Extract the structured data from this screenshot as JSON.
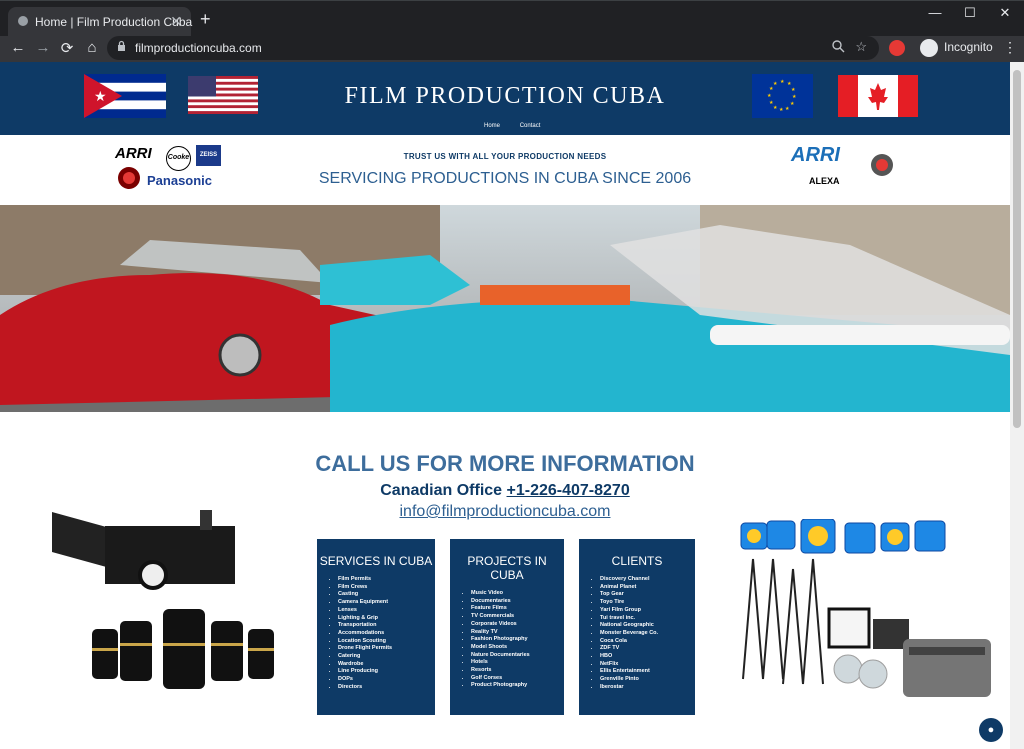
{
  "browser": {
    "tab_title": "Home | Film Production Cuba",
    "tab_close": "✕",
    "new_tab": "+",
    "minimize": "—",
    "maximize": "☐",
    "close_window": "✕",
    "back": "←",
    "forward": "→",
    "reload": "⟳",
    "home": "⌂",
    "url": "filmproductioncuba.com",
    "incognito_label": "Incognito",
    "menu": "⋮"
  },
  "header": {
    "site_title": "FILM PRODUCTION CUBA",
    "nav": [
      "Home",
      "Contact"
    ]
  },
  "brand_strip": {
    "tagline_small": "TRUST US WITH ALL YOUR PRODUCTION NEEDS",
    "tagline_big": "SERVICING PRODUCTIONS IN CUBA SINCE 2006",
    "logos_left": [
      "ARRI",
      "Cooke",
      "ZEISS",
      "Panasonic"
    ],
    "logos_right": [
      "ARRI",
      "ALEXA"
    ]
  },
  "cta": {
    "title": "CALL US FOR MORE INFORMATION",
    "phone_prefix": "Canadian Office",
    "phone": "+1-226-407-8270",
    "email": "info@filmproductioncuba.com"
  },
  "services": {
    "title": "SERVICES IN CUBA",
    "items": [
      "Film Permits",
      "Film Crews",
      "Casting",
      "Camera Equipment",
      "Lenses",
      "Lighting & Grip",
      "Transportation",
      "Accommodations",
      "Location Scouting",
      "Drone Flight Permits",
      "Catering",
      "Wardrobe",
      "Line Producing",
      "DOPs",
      "Directors"
    ]
  },
  "projects": {
    "title": "PROJECTS IN CUBA",
    "items": [
      "Music Video",
      "Documentaries",
      "Feature Films",
      "TV Commercials",
      "Corporate Videos",
      "Reality TV",
      "Fashion Photography",
      "Model Shoots",
      "Nature Documentaries",
      "Hotels",
      "Resorts",
      "Golf Corses",
      "Product Photography"
    ]
  },
  "clients": {
    "title": "CLIENTS",
    "items": [
      "Discovery Channel",
      "Animal Planet",
      "Top Gear",
      "Toyo Tire",
      "Yari Film Group",
      "Tui travel inc.",
      "National Geographic",
      "Monster Beverage Co.",
      "Coca Cola",
      "ZDF TV",
      "HBO",
      "NetFlix",
      "Ellis Entertainment",
      "Grenville Pinto",
      "Iberostar"
    ]
  },
  "colors": {
    "navy": "#0e3a66",
    "accent_blue": "#3d6d9c"
  }
}
